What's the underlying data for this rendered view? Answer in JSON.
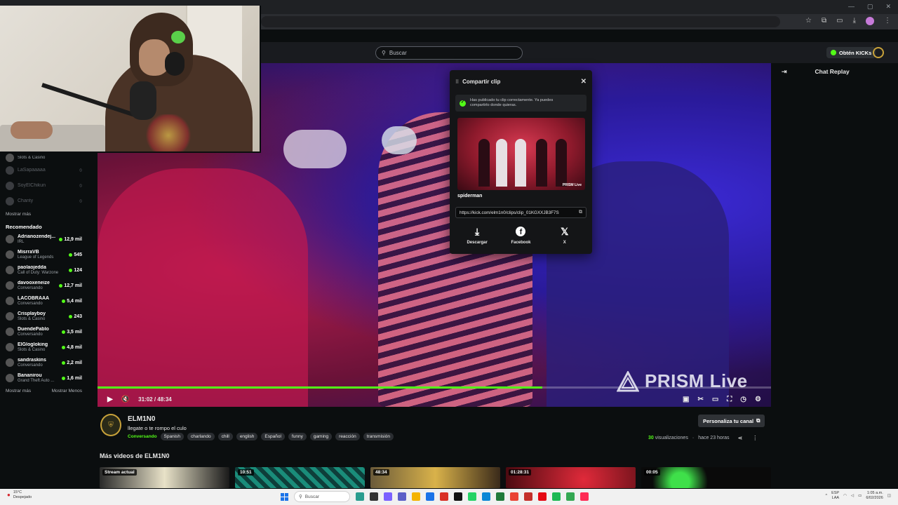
{
  "kick": {
    "search_placeholder": "Buscar",
    "kicks_label": "Obtén KICKs"
  },
  "sidebar": {
    "followed": [
      {
        "name": "",
        "category": "Slots & Casino",
        "viewers": "",
        "online": true
      },
      {
        "name": "LaSapaaaaa",
        "category": "",
        "viewers": "",
        "online": false
      },
      {
        "name": "SoyElChikun",
        "category": "",
        "viewers": "",
        "online": false
      },
      {
        "name": "Chanty",
        "category": "",
        "viewers": "",
        "online": false
      }
    ],
    "show_more": "Mostrar más",
    "recommended_heading": "Recomendado",
    "recommended": [
      {
        "name": "Adrianozendej...",
        "category": "IRL",
        "viewers": "12,9 mil"
      },
      {
        "name": "MisrraVB",
        "category": "League of Legends",
        "viewers": "545"
      },
      {
        "name": "paolaojedda",
        "category": "Call of Duty: Warzone",
        "viewers": "124"
      },
      {
        "name": "davooxeneize",
        "category": "Conversando",
        "viewers": "12,7 mil"
      },
      {
        "name": "LACOBRAAA",
        "category": "Conversando",
        "viewers": "5,4 mil"
      },
      {
        "name": "Crisplayboy",
        "category": "Slots & Casino",
        "viewers": "243"
      },
      {
        "name": "DuendePablo",
        "category": "Conversando",
        "viewers": "3,5 mil"
      },
      {
        "name": "ElGlogloking",
        "category": "Slots & Casino",
        "viewers": "4,8 mil"
      },
      {
        "name": "sandraskins",
        "category": "Conversando",
        "viewers": "2,2 mil"
      },
      {
        "name": "Bananirou",
        "category": "Grand Theft Auto ...",
        "viewers": "1,6 mil"
      }
    ],
    "show_more_2": "Mostrar más",
    "show_less": "Mostrar Menos"
  },
  "player": {
    "time": "31:02 / 48:34",
    "progress": 0.66,
    "watermark": "PRISM Live"
  },
  "share_modal": {
    "title": "Compartir clip",
    "success_line1": "Has publicado tu clip correctamente. Ya puedes",
    "success_line2": "compartirlo donde quieras.",
    "thumb_watermark": "PRISM Live",
    "clip_title": "spiderman",
    "url": "https://kick.com/elm1n0/clips/clip_01KGXXJB3F7S",
    "actions": [
      {
        "label": "Descargar",
        "icon": "download-icon"
      },
      {
        "label": "Facebook",
        "icon": "facebook-icon"
      },
      {
        "label": "X",
        "icon": "x-icon"
      }
    ]
  },
  "chat": {
    "title": "Chat Replay"
  },
  "channel": {
    "name": "ELM1N0",
    "stream_title": "llegate o te rompo el culo",
    "category": "Conversando",
    "tags": [
      "Spanish",
      "charlando",
      "chill",
      "english",
      "Español",
      "funny",
      "gaming",
      "reacción",
      "transmisión"
    ],
    "customize_label": "Personaliza tu canal",
    "views_count": "30",
    "views_label": "visualizaciones",
    "time_ago": "hace 23 horas"
  },
  "more_videos": {
    "heading": "Más videos de ELM1N0",
    "durations": [
      "Stream actual",
      "10:51",
      "48:34",
      "01:28:31",
      "00:05"
    ]
  },
  "taskbar": {
    "temp": "15°C",
    "weather": "Despejado",
    "search": "Buscar",
    "lang": "ESP",
    "lang2": "LAA",
    "time": "1:05 a.m.",
    "date": "6/02/2026"
  },
  "colors": {
    "accent": "#53fc18",
    "background": "#0b0e0f"
  }
}
